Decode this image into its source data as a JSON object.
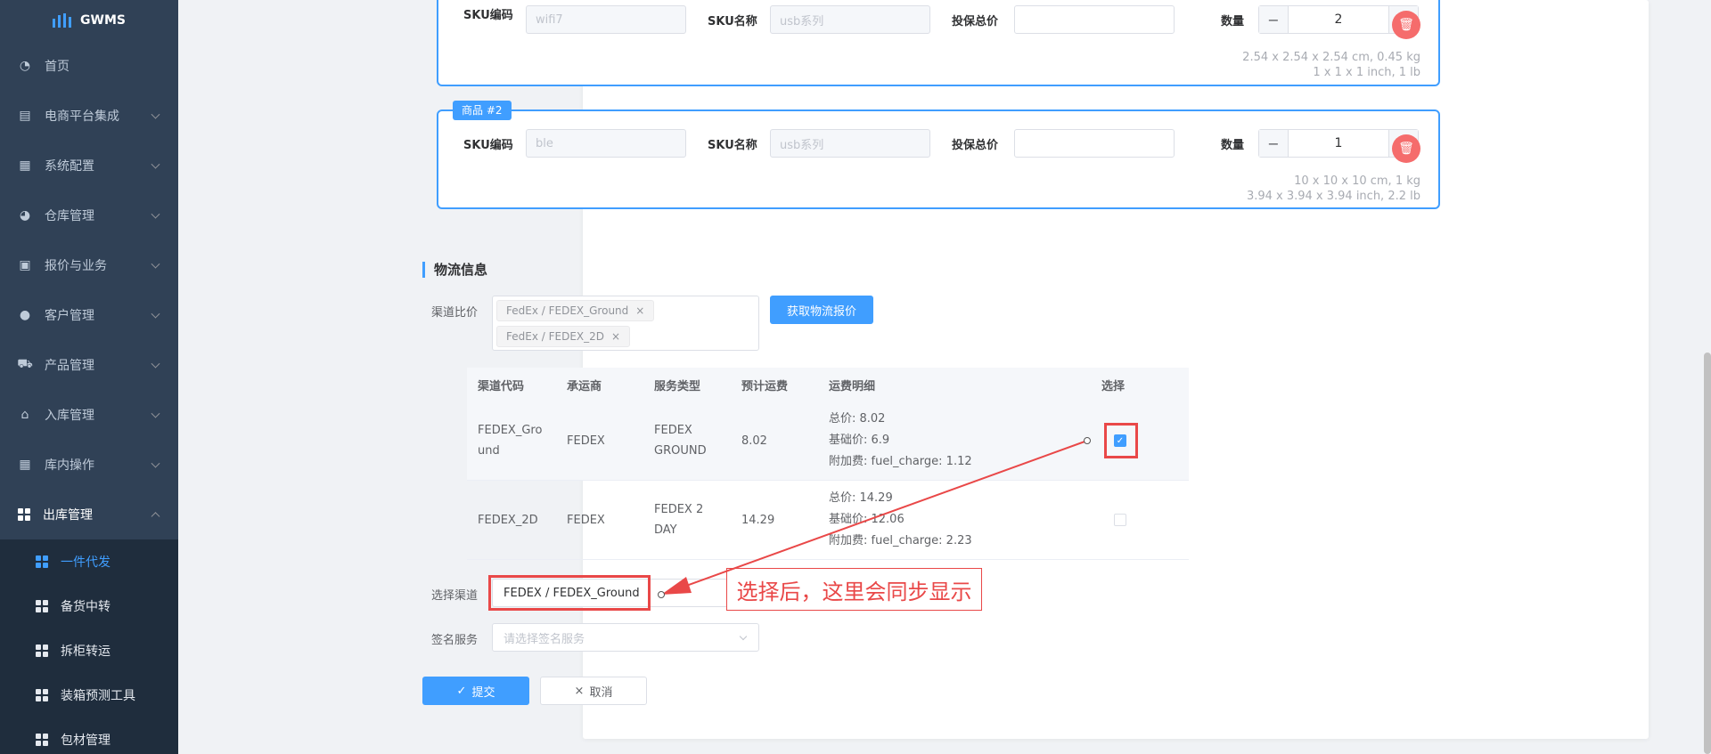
{
  "app": {
    "title": "GWMS"
  },
  "sidebar": {
    "items": [
      {
        "label": "首页",
        "icon": "dashboard-icon"
      },
      {
        "label": "电商平台集成",
        "icon": "store-icon"
      },
      {
        "label": "系统配置",
        "icon": "config-icon"
      },
      {
        "label": "仓库管理",
        "icon": "globe-icon"
      },
      {
        "label": "报价与业务",
        "icon": "quote-icon"
      },
      {
        "label": "客户管理",
        "icon": "user-icon"
      },
      {
        "label": "产品管理",
        "icon": "cart-icon"
      },
      {
        "label": "入库管理",
        "icon": "home-icon"
      },
      {
        "label": "库内操作",
        "icon": "table-icon"
      },
      {
        "label": "出库管理",
        "icon": "grid-icon"
      }
    ],
    "subitems": [
      {
        "label": "一件代发"
      },
      {
        "label": "备货中转"
      },
      {
        "label": "拆柜转运"
      },
      {
        "label": "装箱预测工具"
      },
      {
        "label": "包材管理"
      }
    ]
  },
  "goods": [
    {
      "tag": "",
      "sku_code_label": "SKU编码",
      "sku_code": "wifi7",
      "sku_name_label": "SKU名称",
      "sku_name": "usb系列",
      "insured_label": "投保总价",
      "insured": "",
      "qty_label": "数量",
      "qty": "2",
      "dims_cm": "2.54 x 2.54 x 2.54 cm, 0.45 kg",
      "dims_in": "1 x 1 x 1 inch, 1 lb"
    },
    {
      "tag": "商品 #2",
      "sku_code_label": "SKU编码",
      "sku_code": "ble",
      "sku_name_label": "SKU名称",
      "sku_name": "usb系列",
      "insured_label": "投保总价",
      "insured": "",
      "qty_label": "数量",
      "qty": "1",
      "dims_cm": "10 x 10 x 10 cm, 1 kg",
      "dims_in": "3.94 x 3.94 x 3.94 inch, 2.2 lb"
    }
  ],
  "logistics": {
    "section_title": "物流信息",
    "channel_compare_label": "渠道比价",
    "tags": [
      "FedEx / FEDEX_Ground",
      "FedEx / FEDEX_2D"
    ],
    "fetch_button": "获取物流报价",
    "table": {
      "headers": [
        "渠道代码",
        "承运商",
        "服务类型",
        "预计运费",
        "运费明细",
        "选择"
      ],
      "rows": [
        {
          "code": "FEDEX_Ground",
          "carrier": "FEDEX",
          "service": "FEDEX GROUND",
          "fee": "8.02",
          "detail": [
            "总价: 8.02",
            "基础价: 6.9",
            "附加费: fuel_charge: 1.12"
          ],
          "selected": true
        },
        {
          "code": "FEDEX_2D",
          "carrier": "FEDEX",
          "service": "FEDEX 2 DAY",
          "fee": "14.29",
          "detail": [
            "总价: 14.29",
            "基础价: 12.06",
            "附加费: fuel_charge: 2.23"
          ],
          "selected": false
        }
      ]
    },
    "select_channel_label": "选择渠道",
    "select_channel_value": "FEDEX / FEDEX_Ground",
    "signature_label": "签名服务",
    "signature_placeholder": "请选择签名服务",
    "callout": "选择后，这里会同步显示"
  },
  "actions": {
    "submit": "提交",
    "cancel": "取消"
  },
  "colors": {
    "primary": "#409eff",
    "annotation": "#e94848",
    "sidebar": "#304156"
  }
}
